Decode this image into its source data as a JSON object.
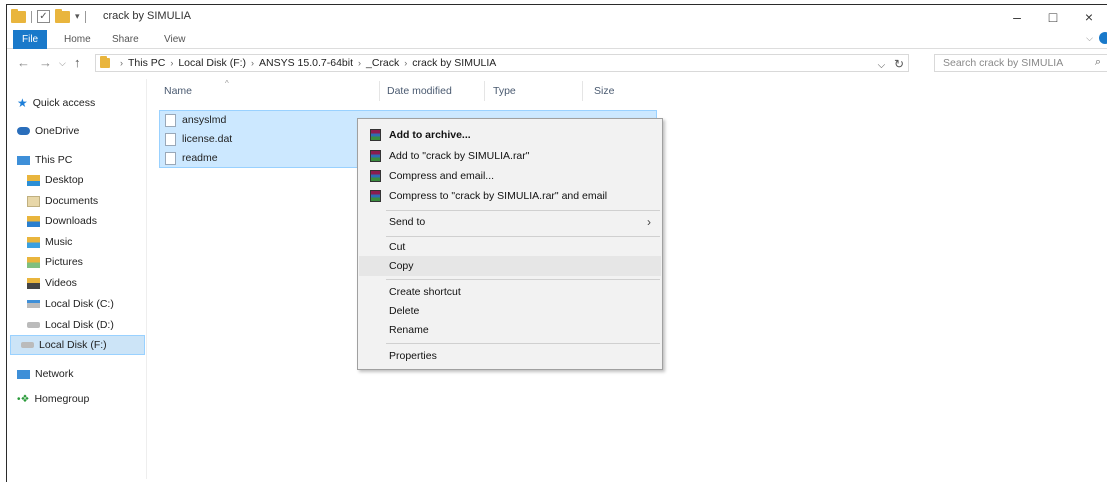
{
  "window": {
    "title": "crack by SIMULIA",
    "controls": [
      "–",
      "□",
      "×"
    ]
  },
  "ribbon": {
    "tabs": [
      "File",
      "Home",
      "Share",
      "View"
    ]
  },
  "address": {
    "crumbs": [
      "This PC",
      "Local Disk (F:)",
      "ANSYS 15.0.7-64bit",
      "_Crack",
      "crack by SIMULIA"
    ],
    "search_placeholder": "Search crack by SIMULIA"
  },
  "navpane": {
    "items": [
      {
        "label": "Quick access",
        "icon": "star-icon"
      },
      {
        "label": "OneDrive",
        "icon": "cloud-icon"
      },
      {
        "label": "This PC",
        "icon": "computer-icon"
      },
      {
        "label": "Desktop",
        "icon": "desktop-folder-icon"
      },
      {
        "label": "Documents",
        "icon": "documents-folder-icon"
      },
      {
        "label": "Downloads",
        "icon": "downloads-folder-icon"
      },
      {
        "label": "Music",
        "icon": "music-folder-icon"
      },
      {
        "label": "Pictures",
        "icon": "pictures-folder-icon"
      },
      {
        "label": "Videos",
        "icon": "videos-folder-icon"
      },
      {
        "label": "Local Disk (C:)",
        "icon": "drive-icon"
      },
      {
        "label": "Local Disk (D:)",
        "icon": "drive-icon"
      },
      {
        "label": "Local Disk (F:)",
        "icon": "drive-icon"
      },
      {
        "label": "Network",
        "icon": "network-icon"
      },
      {
        "label": "Homegroup",
        "icon": "homegroup-icon"
      }
    ],
    "selected": "Local Disk (F:)"
  },
  "columns": [
    "Name",
    "Date modified",
    "Type",
    "Size"
  ],
  "files": [
    {
      "name": "ansyslmd"
    },
    {
      "name": "license.dat"
    },
    {
      "name": "readme"
    }
  ],
  "context_menu": {
    "items": [
      {
        "label": "Add to archive...",
        "icon": "winrar-icon",
        "bold": true
      },
      {
        "label": "Add to \"crack by SIMULIA.rar\"",
        "icon": "winrar-icon"
      },
      {
        "label": "Compress and email...",
        "icon": "winrar-icon"
      },
      {
        "label": "Compress to \"crack by SIMULIA.rar\" and email",
        "icon": "winrar-icon"
      },
      {
        "label": "Send to",
        "submenu": true
      },
      {
        "label": "Cut"
      },
      {
        "label": "Copy",
        "highlighted": true
      },
      {
        "label": "Create shortcut"
      },
      {
        "label": "Delete"
      },
      {
        "label": "Rename"
      },
      {
        "label": "Properties"
      }
    ]
  },
  "colors": {
    "accent": "#1979ca",
    "selection": "#cce8ff",
    "folder": "#e9b53d"
  }
}
